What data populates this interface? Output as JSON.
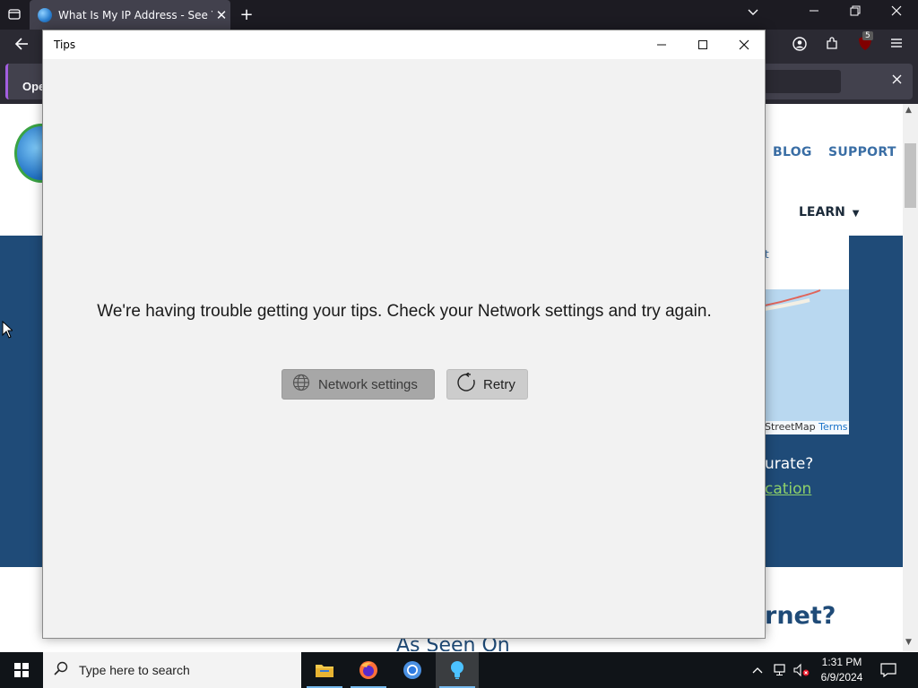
{
  "browser": {
    "tab_title": "What Is My IP Address - See Your",
    "new_tab_symbol": "+",
    "notification_button": "Oper",
    "extension_badge": "5"
  },
  "website": {
    "nav_blog": "BLOG",
    "nav_support": "SUPPORT",
    "nav_learn": "LEARN",
    "dropdown_fragment": "t",
    "map_attribution": "StreetMap",
    "map_terms": "Terms",
    "question_fragment": "urate?",
    "link_fragment": "cation",
    "heading_fragment": "rnet?",
    "as_seen_on": "As Seen On"
  },
  "dialog": {
    "title": "Tips",
    "message": "We're having trouble getting your tips. Check your Network settings and try again.",
    "network_button": "Network settings",
    "retry_button": "Retry"
  },
  "taskbar": {
    "search_placeholder": "Type here to search",
    "time": "1:31 PM",
    "date": "6/9/2024"
  },
  "colors": {
    "site_blue": "#1f4b78",
    "link_green": "#8fd16a",
    "taskbar": "#101418"
  }
}
